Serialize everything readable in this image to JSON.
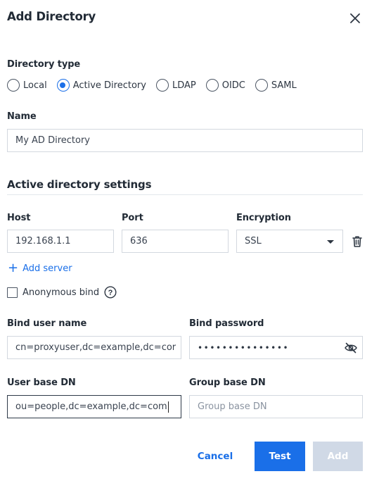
{
  "dialog": {
    "title": "Add Directory"
  },
  "directory_type": {
    "label": "Directory type",
    "options": [
      {
        "label": "Local",
        "selected": false
      },
      {
        "label": "Active Directory",
        "selected": true
      },
      {
        "label": "LDAP",
        "selected": false
      },
      {
        "label": "OIDC",
        "selected": false
      },
      {
        "label": "SAML",
        "selected": false
      }
    ]
  },
  "name": {
    "label": "Name",
    "value": "My AD Directory"
  },
  "ad_settings": {
    "heading": "Active directory settings",
    "host": {
      "label": "Host",
      "value": "192.168.1.1"
    },
    "port": {
      "label": "Port",
      "value": "636"
    },
    "encryption": {
      "label": "Encryption",
      "value": "SSL"
    },
    "add_server_label": "Add server",
    "anonymous_bind": {
      "label": "Anonymous bind",
      "checked": false,
      "help_glyph": "?"
    },
    "bind_user": {
      "label": "Bind user name",
      "value": "cn=proxyuser,dc=example,dc=cor"
    },
    "bind_password": {
      "label": "Bind password",
      "value": "•••••••••••••••"
    },
    "user_base_dn": {
      "label": "User base DN",
      "value": "ou=people,dc=example,dc=com"
    },
    "group_base_dn": {
      "label": "Group base DN",
      "value": "",
      "placeholder": "Group base DN"
    }
  },
  "actions": {
    "cancel": "Cancel",
    "test": "Test",
    "add": "Add"
  },
  "colors": {
    "accent": "#1a6fe8",
    "disabled": "#d0d9e6"
  },
  "icons": {
    "close": "close-icon",
    "delete": "trash-icon",
    "help": "help-circle-icon",
    "visibility": "eye-off-icon"
  }
}
